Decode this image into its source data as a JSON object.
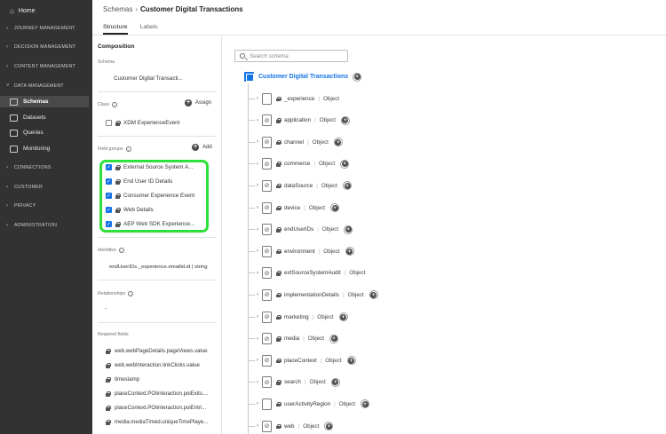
{
  "sidebar": {
    "home": "Home",
    "sections": [
      {
        "label": "JOURNEY MANAGEMENT"
      },
      {
        "label": "DECISION MANAGEMENT"
      },
      {
        "label": "CONTENT MANAGEMENT"
      },
      {
        "label": "DATA MANAGEMENT"
      }
    ],
    "items": [
      {
        "label": "Schemas"
      },
      {
        "label": "Datasets"
      },
      {
        "label": "Queries"
      },
      {
        "label": "Monitoring"
      }
    ],
    "sections_bottom": [
      {
        "label": "CONNECTIONS"
      },
      {
        "label": "CUSTOMER"
      },
      {
        "label": "PRIVACY"
      },
      {
        "label": "ADMINISTRATION"
      }
    ]
  },
  "header": {
    "breadcrumb_parent": "Schemas",
    "breadcrumb_separator": "›",
    "title": "Customer Digital Transactions",
    "tabs": [
      {
        "label": "Structure"
      },
      {
        "label": "Labels"
      }
    ]
  },
  "composition": {
    "title": "Composition",
    "schema_label": "Schema",
    "schema_value": "Customer Digital Transacti...",
    "class_label": "Class",
    "assign_label": "Assign",
    "class_value": "XDM ExperienceEvent",
    "field_groups_label": "Field groups",
    "add_label": "Add",
    "field_groups": [
      {
        "label": "External Source System A..."
      },
      {
        "label": "End User ID Details"
      },
      {
        "label": "Consumer Experience Event"
      },
      {
        "label": "Web Details"
      },
      {
        "label": "AEP Web SDK Experience..."
      }
    ],
    "identities_label": "Identities",
    "identity_value": "endUserIDs._experience.emailid.id | string",
    "relationships_label": "Relationships",
    "relationships_value": "-",
    "required_label": "Required fields",
    "required_fields": [
      {
        "label": "web.webPageDetails.pageViews.value"
      },
      {
        "label": "web.webInteraction.linkClicks.value"
      },
      {
        "label": "timestamp"
      },
      {
        "label": "placeContext.POIinteraction.poiExits...."
      },
      {
        "label": "placeContext.POIinteraction.poiEntri..."
      },
      {
        "label": "media.mediaTimed.uniqueTimePlaye..."
      }
    ]
  },
  "canvas": {
    "search_placeholder": "Search schema",
    "root_label": "Customer Digital Transactions",
    "fields": [
      {
        "name": "_experience",
        "type": "Object",
        "addable": false,
        "linked": false
      },
      {
        "name": "application",
        "type": "Object",
        "addable": true,
        "linked": true
      },
      {
        "name": "channel",
        "type": "Object",
        "addable": true,
        "linked": true
      },
      {
        "name": "commerce",
        "type": "Object",
        "addable": true,
        "linked": true
      },
      {
        "name": "dataSource",
        "type": "Object",
        "addable": true,
        "linked": true
      },
      {
        "name": "device",
        "type": "Object",
        "addable": true,
        "linked": true
      },
      {
        "name": "endUserIDs",
        "type": "Object",
        "addable": true,
        "linked": true
      },
      {
        "name": "environment",
        "type": "Object",
        "addable": true,
        "linked": true
      },
      {
        "name": "extSourceSystemAudit",
        "type": "Object",
        "addable": false,
        "linked": true
      },
      {
        "name": "implementationDetails",
        "type": "Object",
        "addable": true,
        "linked": true
      },
      {
        "name": "marketing",
        "type": "Object",
        "addable": true,
        "linked": true
      },
      {
        "name": "media",
        "type": "Object",
        "addable": true,
        "linked": true
      },
      {
        "name": "placeContext",
        "type": "Object",
        "addable": true,
        "linked": true
      },
      {
        "name": "search",
        "type": "Object",
        "addable": true,
        "linked": true
      },
      {
        "name": "userActivityRegion",
        "type": "Object",
        "addable": true,
        "linked": false
      },
      {
        "name": "web",
        "type": "Object",
        "addable": true,
        "linked": true
      }
    ],
    "separator": "|"
  },
  "colors": {
    "accent": "#1473e6",
    "highlight": "#2de03a",
    "sidebar": "#323232"
  }
}
